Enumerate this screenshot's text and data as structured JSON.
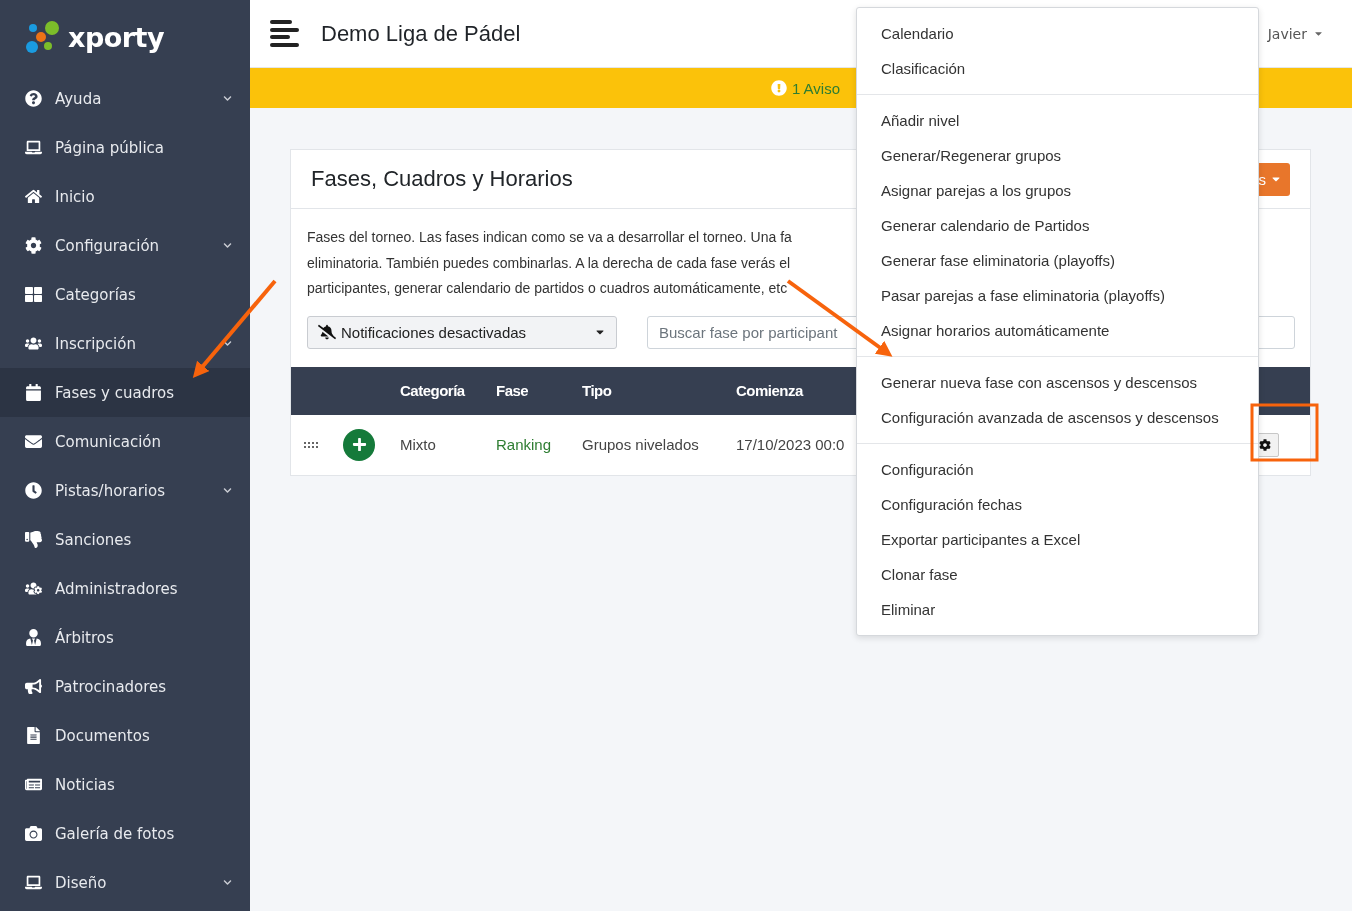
{
  "logo": {
    "text": "xporty"
  },
  "sidebar": {
    "items": [
      {
        "label": "Ayuda",
        "has_submenu": true,
        "selected": false
      },
      {
        "label": "Página pública",
        "has_submenu": false,
        "selected": false
      },
      {
        "label": "Inicio",
        "has_submenu": false,
        "selected": false
      },
      {
        "label": "Configuración",
        "has_submenu": true,
        "selected": false
      },
      {
        "label": "Categorías",
        "has_submenu": false,
        "selected": false
      },
      {
        "label": "Inscripción",
        "has_submenu": true,
        "selected": false
      },
      {
        "label": "Fases y cuadros",
        "has_submenu": false,
        "selected": true
      },
      {
        "label": "Comunicación",
        "has_submenu": false,
        "selected": false
      },
      {
        "label": "Pistas/horarios",
        "has_submenu": true,
        "selected": false
      },
      {
        "label": "Sanciones",
        "has_submenu": false,
        "selected": false
      },
      {
        "label": "Administradores",
        "has_submenu": false,
        "selected": false
      },
      {
        "label": "Árbitros",
        "has_submenu": false,
        "selected": false
      },
      {
        "label": "Patrocinadores",
        "has_submenu": false,
        "selected": false
      },
      {
        "label": "Documentos",
        "has_submenu": false,
        "selected": false
      },
      {
        "label": "Noticias",
        "has_submenu": false,
        "selected": false
      },
      {
        "label": "Galería de fotos",
        "has_submenu": false,
        "selected": false
      },
      {
        "label": "Diseño",
        "has_submenu": true,
        "selected": false
      }
    ]
  },
  "header": {
    "title": "Demo Liga de Pádel",
    "user": "Javier"
  },
  "alert_bar": {
    "text": "1 Aviso"
  },
  "card": {
    "title": "Fases, Cuadros y Horarios",
    "action_button": "s",
    "description_lines": [
      "Fases del torneo. Las fases indican como se va a desarrollar el torneo. Una fa",
      "eliminatoria. También puedes combinarlas. A la derecha de cada fase verás el",
      "participantes, generar calendario de partidos o cuadros automáticamente, etc"
    ],
    "notifications_select": "Notificaciones desactivadas",
    "search": {
      "placeholder": "Buscar fase por participant"
    },
    "table": {
      "columns": [
        "Categoría",
        "Fase",
        "Tipo",
        "Comienza"
      ],
      "rows": [
        {
          "category": "Mixto",
          "phase": "Ranking",
          "type": "Grupos nivelados",
          "start": "17/10/2023 00:0"
        }
      ]
    }
  },
  "dropdown_menu": {
    "groups": [
      [
        "Calendario",
        "Clasificación"
      ],
      [
        "Añadir nivel",
        "Generar/Regenerar grupos",
        "Asignar parejas a los grupos",
        "Generar calendario de Partidos",
        "Generar fase eliminatoria (playoffs)",
        "Pasar parejas a fase eliminatoria (playoffs)",
        "Asignar horarios automáticamente"
      ],
      [
        "Generar nueva fase con ascensos y descensos",
        "Configuración avanzada de ascensos y descensos"
      ],
      [
        "Configuración",
        "Configuración fechas",
        "Exportar participantes a Excel",
        "Clonar fase",
        "Eliminar"
      ]
    ]
  }
}
